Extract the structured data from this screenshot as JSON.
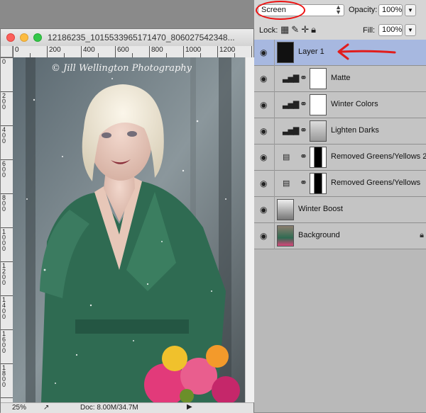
{
  "window": {
    "title": "12186235_1015533965171470_806027542348...",
    "ruler_top": [
      "0",
      "200",
      "400",
      "600",
      "800",
      "1000",
      "1200"
    ],
    "ruler_left": [
      "0",
      "200",
      "400",
      "600",
      "800",
      "1000",
      "1200",
      "1400",
      "1600",
      "1800"
    ],
    "zoom": "25%",
    "doc_size": "Doc: 8.00M/34.7M",
    "watermark": "© Jill Wellington Photography"
  },
  "layers_panel": {
    "blend_mode": "Screen",
    "opacity_label": "Opacity:",
    "opacity_value": "100%",
    "lock_label": "Lock:",
    "fill_label": "Fill:",
    "fill_value": "100%",
    "layers": [
      {
        "name": "Layer 1",
        "selected": true
      },
      {
        "name": "Matte"
      },
      {
        "name": "Winter Colors"
      },
      {
        "name": "Lighten Darks"
      },
      {
        "name": "Removed Greens/Yellows 2"
      },
      {
        "name": "Removed Greens/Yellows"
      },
      {
        "name": "Winter Boost"
      },
      {
        "name": "Background"
      }
    ]
  },
  "colors": {
    "annotation": "#e11d1d",
    "selected_layer": "#a7b8e0",
    "dress": "#2f6b52"
  }
}
